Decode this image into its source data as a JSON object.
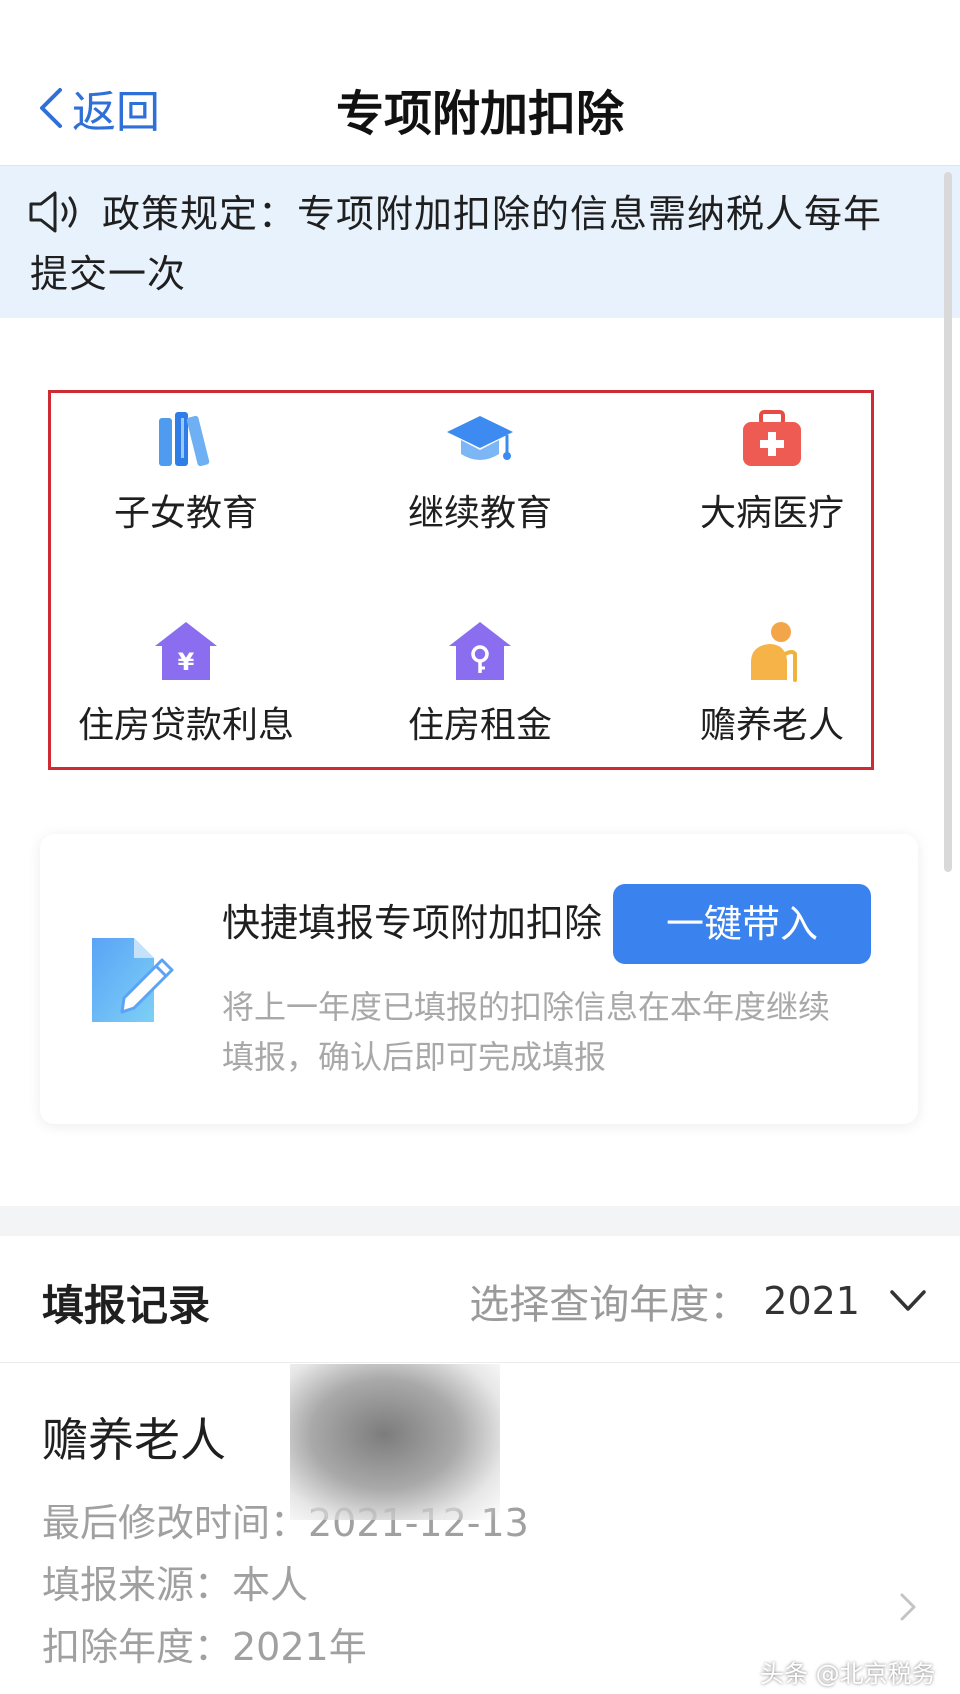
{
  "nav": {
    "back_label": "返回",
    "title": "专项附加扣除"
  },
  "notice": {
    "line1": "政策规定：专项附加扣除的信息需纳税人每年",
    "line2": "提交一次"
  },
  "categories": [
    {
      "label": "子女教育",
      "icon": "books-icon"
    },
    {
      "label": "继续教育",
      "icon": "graduation-cap-icon"
    },
    {
      "label": "大病医疗",
      "icon": "medical-kit-icon"
    },
    {
      "label": "住房贷款利息",
      "icon": "house-yuan-icon"
    },
    {
      "label": "住房租金",
      "icon": "house-key-icon"
    },
    {
      "label": "赡养老人",
      "icon": "elderly-person-icon"
    }
  ],
  "quick_fill": {
    "title": "快捷填报专项附加扣除",
    "button": "一键带入",
    "desc_line1": "将上一年度已填报的扣除信息在本年度继续",
    "desc_line2": "填报，确认后即可完成填报"
  },
  "records": {
    "title": "填报记录",
    "year_label": "选择查询年度：",
    "year_value": "2021",
    "items": [
      {
        "name": "赡养老人",
        "modified": "最后修改时间：2021-12-13",
        "source": "填报来源：本人",
        "year": "扣除年度：2021年"
      }
    ]
  },
  "watermark": "头条 @北京税务",
  "colors": {
    "accent": "#3a82ee",
    "highlight_border": "#cf2b34",
    "notice_bg": "#e8f2fd"
  }
}
